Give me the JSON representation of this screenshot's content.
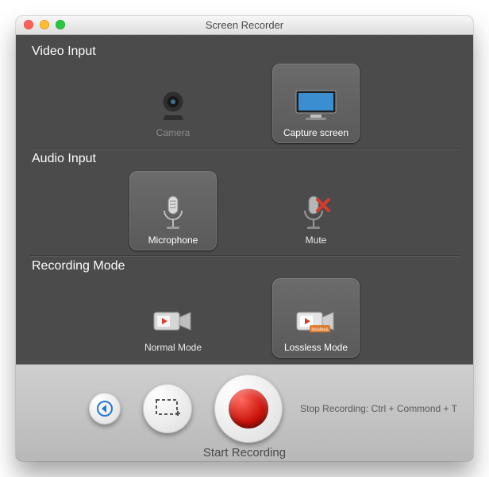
{
  "window": {
    "title": "Screen Recorder"
  },
  "sections": {
    "video": {
      "heading": "Video Input",
      "camera": "Camera",
      "capture": "Capture screen"
    },
    "audio": {
      "heading": "Audio Input",
      "mic": "Microphone",
      "mute": "Mute"
    },
    "mode": {
      "heading": "Recording Mode",
      "normal": "Normal Mode",
      "lossless": "Lossless Mode",
      "lossless_badge": "lossless"
    }
  },
  "selection": {
    "video": "capture",
    "audio": "mic",
    "mode": "lossless"
  },
  "footer": {
    "start_label": "Start Recording",
    "hint": "Stop Recording: Ctrl + Commond + T"
  },
  "colors": {
    "record": "#c91108",
    "accent_back": "#1e78d6"
  }
}
